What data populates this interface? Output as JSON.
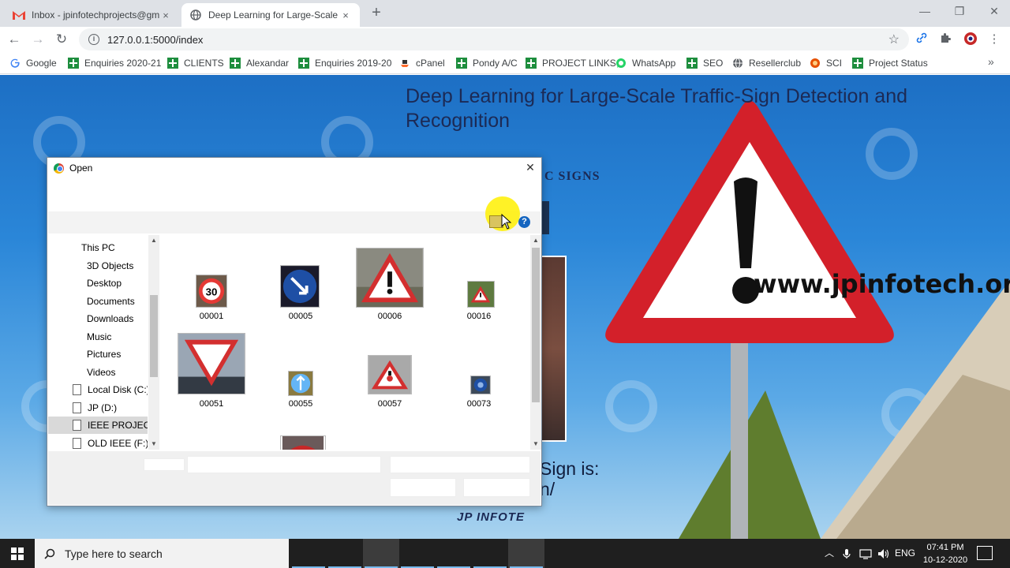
{
  "browser": {
    "tabs": [
      {
        "title": "Inbox - jpinfotechprojects@gmail.com",
        "icon": "gmail-icon",
        "close": "×"
      },
      {
        "title": "Deep Learning for Large-Scale Traffic",
        "icon": "globe-icon",
        "close": "×"
      }
    ],
    "new_tab": "+",
    "window": {
      "minimize": "—",
      "maximize": "❐",
      "close": "✕"
    },
    "nav": {
      "back": "←",
      "forward": "→",
      "reload": "↻"
    },
    "url": "127.0.0.1:5000/index",
    "bookmarks": [
      {
        "label": "Google",
        "icon": "google-icon"
      },
      {
        "label": "Enquiries 2020-21",
        "icon": "sheets-icon"
      },
      {
        "label": "CLIENTS",
        "icon": "sheets-icon"
      },
      {
        "label": "Alexandar",
        "icon": "sheets-icon"
      },
      {
        "label": "Enquiries 2019-20",
        "icon": "sheets-icon"
      },
      {
        "label": "cPanel",
        "icon": "cpanel-icon"
      },
      {
        "label": "Pondy A/C",
        "icon": "sheets-icon"
      },
      {
        "label": "PROJECT LINKS",
        "icon": "sheets-icon"
      },
      {
        "label": "WhatsApp",
        "icon": "whatsapp-icon"
      },
      {
        "label": "SEO",
        "icon": "sheets-icon"
      },
      {
        "label": "Resellerclub",
        "icon": "globe-icon"
      },
      {
        "label": "SCI",
        "icon": "sci-icon"
      },
      {
        "label": "Project Status",
        "icon": "sheets-icon"
      }
    ],
    "bookmarks_more": "»"
  },
  "page": {
    "title": "Deep Learning for Large-Scale Traffic-Sign Detection and Recognition",
    "subtitle_fragment": "C SIGNS",
    "result_fragment_1": "Sign is:",
    "result_fragment_2": "n/",
    "watermark": "www.jpinfotech.org",
    "logo_text": "JP INFOTE"
  },
  "dialog": {
    "title": "Open",
    "close": "✕",
    "help": "?",
    "nav_items": [
      {
        "label": "This PC",
        "type": "root"
      },
      {
        "label": "3D Objects",
        "type": "folder"
      },
      {
        "label": "Desktop",
        "type": "folder"
      },
      {
        "label": "Documents",
        "type": "folder"
      },
      {
        "label": "Downloads",
        "type": "folder"
      },
      {
        "label": "Music",
        "type": "folder"
      },
      {
        "label": "Pictures",
        "type": "folder"
      },
      {
        "label": "Videos",
        "type": "folder"
      },
      {
        "label": "Local Disk (C:)",
        "type": "drive"
      },
      {
        "label": "JP (D:)",
        "type": "drive"
      },
      {
        "label": "IEEE PROJECTS (E:)",
        "type": "drive",
        "selected": true
      },
      {
        "label": "OLD IEEE (F:)",
        "type": "drive"
      }
    ],
    "files": [
      {
        "name": "00001",
        "icon": "speed-limit-30-thumbnail"
      },
      {
        "name": "00005",
        "icon": "keep-left-sign-thumbnail"
      },
      {
        "name": "00006",
        "icon": "warning-triangle-thumbnail"
      },
      {
        "name": "00016",
        "icon": "warning-triangle-small-thumbnail"
      },
      {
        "name": "00051",
        "icon": "yield-sign-thumbnail"
      },
      {
        "name": "00055",
        "icon": "mandatory-direction-thumbnail"
      },
      {
        "name": "00057",
        "icon": "warning-triangle-road-thumbnail"
      },
      {
        "name": "00073",
        "icon": "blue-round-sign-thumbnail"
      },
      {
        "name": "",
        "icon": "partial-thumbnail"
      }
    ]
  },
  "taskbar": {
    "search_placeholder": "Type here to search",
    "language": "ENG",
    "time": "07:41 PM",
    "date": "10-12-2020"
  }
}
